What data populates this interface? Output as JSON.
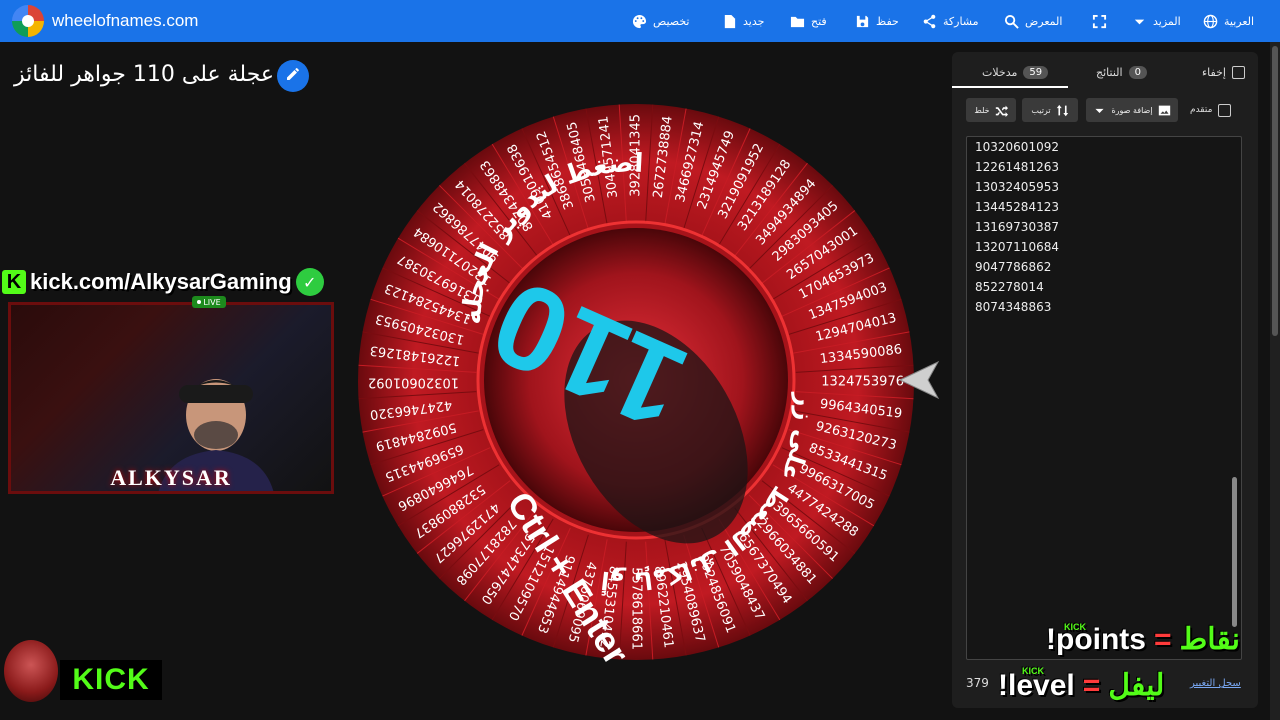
{
  "app": {
    "site": "wheelofnames.com"
  },
  "toolbar": {
    "customize": "تخصيص",
    "new": "جديد",
    "open": "فتح",
    "save": "حفظ",
    "share": "مشاركة",
    "gallery": "المعرض",
    "more": "المزيد",
    "language": "العربية"
  },
  "wheel": {
    "title": "عجلة على 110 جواهر للفائز",
    "center_text": "110",
    "spin_hint": "اضغط لتدوير العجلة",
    "ctrl_hint": "أو بإمكانك الضغط على زر",
    "shortcut": "Ctrl + Enter",
    "segment_labels": [
      "10320601092",
      "12261481263",
      "13032405953",
      "13445284123",
      "13169730387",
      "13207110684",
      "9047786862",
      "852278014",
      "8074348863",
      "4109019638",
      "3868654512",
      "3059468405",
      "3049571241",
      "3928041345",
      "2672738884",
      "3466927314",
      "2314945749",
      "3219091952",
      "3213189128",
      "3494934894",
      "2983093405",
      "2657043001",
      "1704653973",
      "1347594003",
      "1294704013",
      "1334590086",
      "1324753976",
      "9964340519",
      "9263120273",
      "8533441315",
      "9966317005",
      "4477424288",
      "3965660591",
      "2966034881",
      "6567370494",
      "7059048437",
      "9024856091",
      "2954089637",
      "8962210461",
      "5578618661",
      "8455310412",
      "4376069095",
      "9114944653",
      "1512109570",
      "5734747650",
      "7828177098",
      "4712976627",
      "5328809837",
      "7646640896",
      "6596944315",
      "5092844819",
      "4247466320"
    ]
  },
  "stream": {
    "kick_url": "kick.com/AlkysarGaming",
    "live": "LIVE",
    "streamer_name": "ALKYSAR",
    "kick_logo": "KICK",
    "cmd_points_ar": "نقاط",
    "cmd_points_en": "!points",
    "cmd_level_ar": "ليفل",
    "cmd_level_en": "!level",
    "eq": "=",
    "kick_tag": "KICK"
  },
  "panel": {
    "tab_entries": "مدخلات",
    "entries_count": "59",
    "tab_results": "النتائج",
    "results_count": "0",
    "hide": "إخفاء",
    "shuffle": "خلط",
    "sort": "ترتيب",
    "add_image": "إضافة صورة",
    "advanced": "متقدم",
    "entries": [
      "10320601092",
      "12261481263",
      "13032405953",
      "13445284123",
      "13169730387",
      "13207110684",
      "9047786862",
      "852278014",
      "8074348863"
    ],
    "total": "379",
    "history": "سجل التغيير"
  },
  "colors": {
    "accent": "#1a73e8",
    "wheel_red": "#b3141c",
    "wheel_dark": "#5a0a0e",
    "center_cyan": "#18c8e8",
    "kick_green": "#53fc18"
  }
}
